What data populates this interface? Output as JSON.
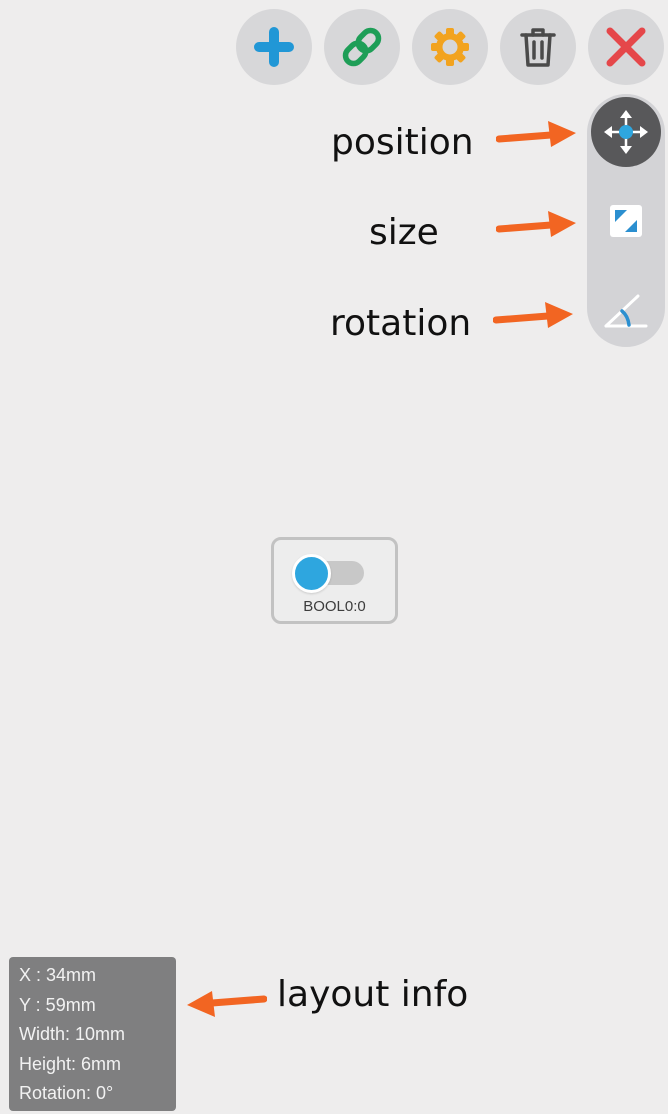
{
  "toolbar": {
    "buttons": [
      {
        "name": "add-button",
        "icon": "plus-icon"
      },
      {
        "name": "link-button",
        "icon": "link-icon"
      },
      {
        "name": "settings-button",
        "icon": "gear-icon"
      },
      {
        "name": "delete-button",
        "icon": "trash-icon"
      },
      {
        "name": "close-button",
        "icon": "close-icon"
      }
    ]
  },
  "mode_panel": {
    "modes": [
      {
        "name": "position",
        "icon": "move-arrows-icon",
        "active": true
      },
      {
        "name": "size",
        "icon": "resize-icon",
        "active": false
      },
      {
        "name": "rotation",
        "icon": "angle-icon",
        "active": false
      }
    ]
  },
  "annotations": {
    "position": "position",
    "size": "size",
    "rotation": "rotation",
    "layout_info": "layout info"
  },
  "widget": {
    "label": "BOOL0:0",
    "state": "on"
  },
  "layout_info": {
    "x": "X  : 34mm",
    "y": "Y  : 59mm",
    "width": "Width: 10mm",
    "height": "Height: 6mm",
    "rotation": "Rotation: 0°"
  },
  "colors": {
    "background": "#eeeded",
    "accent_blue": "#2ea6df",
    "link_green": "#1e9e57",
    "gear_orange": "#f2a31f",
    "close_red": "#e5474a",
    "annotation_arrow": "#f26522"
  }
}
